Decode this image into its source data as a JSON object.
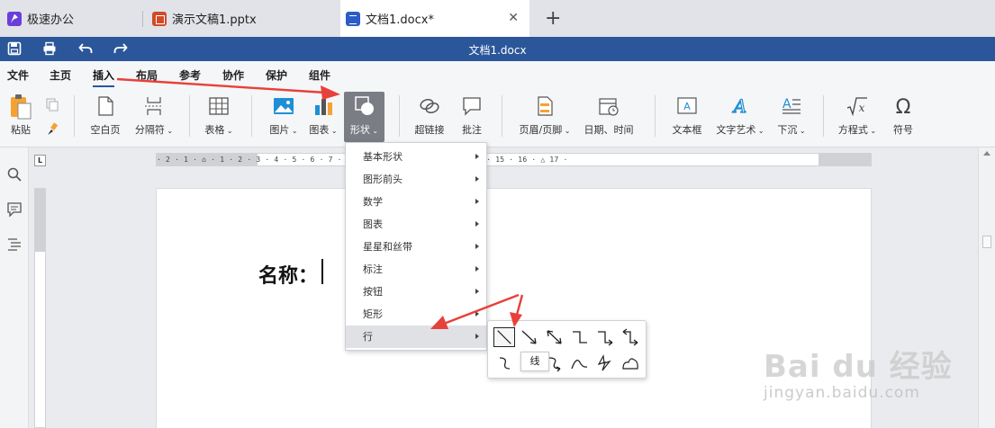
{
  "tabs": [
    {
      "label": "极速办公",
      "icon": "app-logo-icon"
    },
    {
      "label": "演示文稿1.pptx",
      "icon": "presentation-icon"
    },
    {
      "label": "文档1.docx*",
      "icon": "document-icon",
      "active": true
    }
  ],
  "titlebar": {
    "title": "文档1.docx",
    "bg": "#2b579a"
  },
  "menu": [
    "文件",
    "主页",
    "插入",
    "布局",
    "参考",
    "协作",
    "保护",
    "组件"
  ],
  "menu_active": "插入",
  "ribbon": {
    "paste": "粘贴",
    "blank_page": "空白页",
    "separator": "分隔符",
    "table": "表格",
    "picture": "图片",
    "chart": "图表",
    "shapes": "形状",
    "hyperlink": "超链接",
    "comment": "批注",
    "header_footer": "页眉/页脚",
    "date_time": "日期、时间",
    "textbox": "文本框",
    "wordart": "文字艺术",
    "dropcap": "下沉",
    "equation": "方程式",
    "symbol": "符号"
  },
  "ruler": {
    "corner": "L",
    "ticks": "· 2 · 1 · ⌂ · 1 · 2 · 3 · 4 · 5 · 6 · 7 · 8 · 9 · 10 · 11 · 12 · 13 · 14 · 15 · 16 · △ 17 ·"
  },
  "document": {
    "text": "名称："
  },
  "shapes_menu": {
    "items": [
      "基本形状",
      "图形前头",
      "数学",
      "图表",
      "星星和丝带",
      "标注",
      "按钮",
      "矩形",
      "行"
    ],
    "highlighted": "行"
  },
  "lines_submenu": {
    "tooltip": "线",
    "icons": [
      "line-icon",
      "arrow-line-icon",
      "double-arrow-line-icon",
      "elbow-connector-icon",
      "elbow-arrow-connector-icon",
      "elbow-double-arrow-connector-icon",
      "curved-connector-icon",
      "curved-arrow-connector-icon",
      "curve-icon",
      "freeform-icon",
      "scribble-icon"
    ]
  },
  "watermark": {
    "brand": "Bai du 经验",
    "url": "jingyan.baidu.com"
  },
  "colors": {
    "accent": "#2b579a",
    "annotation": "#e8403a"
  }
}
